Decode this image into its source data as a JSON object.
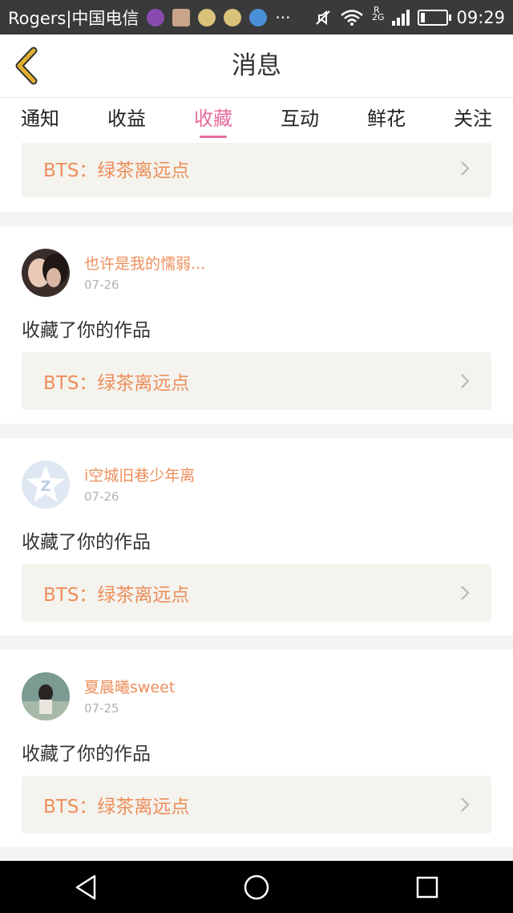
{
  "status_bar": {
    "carrier": "Rogers|中国电信",
    "network": "2G",
    "roaming": "R",
    "time": "09:29",
    "battery_level": 0.15
  },
  "header": {
    "title": "消息",
    "back_icon": "chevron-left-icon"
  },
  "tabs": [
    {
      "label": "通知",
      "active": false
    },
    {
      "label": "收益",
      "active": false
    },
    {
      "label": "收藏",
      "active": true
    },
    {
      "label": "互动",
      "active": false
    },
    {
      "label": "鲜花",
      "active": false
    },
    {
      "label": "关注",
      "active": false
    }
  ],
  "top_partial_card": {
    "work_title": "BTS：绿茶离远点"
  },
  "items": [
    {
      "username": "也许是我的懦弱...",
      "date": "07-26",
      "action": "收藏了你的作品",
      "work_title": "BTS：绿茶离远点"
    },
    {
      "username": "i空城旧巷少年离",
      "date": "07-26",
      "action": "收藏了你的作品",
      "work_title": "BTS：绿茶离远点"
    },
    {
      "username": "夏晨曦sweet",
      "date": "07-25",
      "action": "收藏了你的作品",
      "work_title": "BTS：绿茶离远点"
    }
  ],
  "colors": {
    "accent": "#e86c9c",
    "username": "#ed8e5b",
    "work_box_bg": "#f4f3ee",
    "back_icon": "#e0b030"
  }
}
